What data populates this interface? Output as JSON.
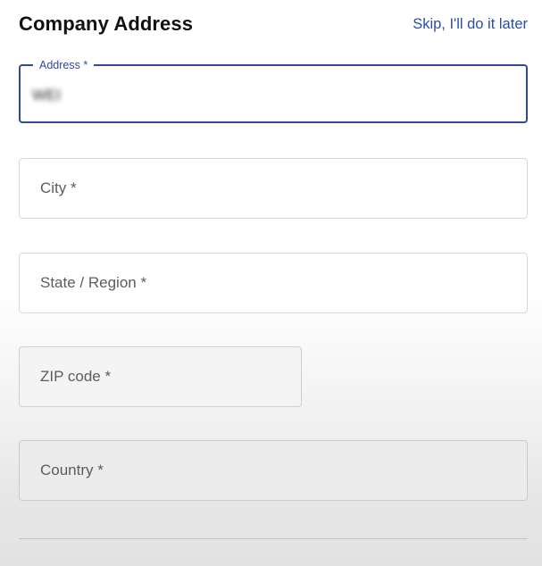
{
  "header": {
    "title": "Company Address",
    "skip_label": "Skip, I'll do it later"
  },
  "form": {
    "address": {
      "label": "Address *",
      "value": "WEI"
    },
    "city": {
      "placeholder": "City *"
    },
    "state": {
      "placeholder": "State / Region *"
    },
    "zip": {
      "placeholder": "ZIP code *"
    },
    "country": {
      "placeholder": "Country *"
    }
  },
  "colors": {
    "accent": "#2f4a9a",
    "link": "#2b4da8"
  }
}
